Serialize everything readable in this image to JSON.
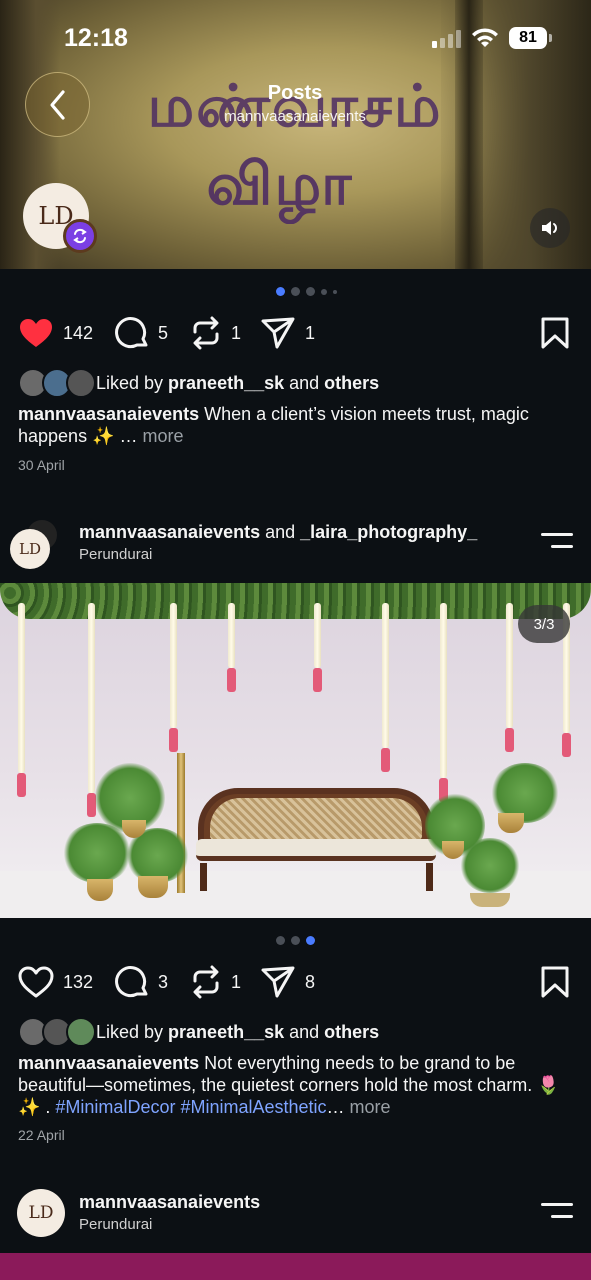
{
  "status_bar": {
    "time": "12:18",
    "battery": "81"
  },
  "header": {
    "title": "Posts",
    "subtitle": "mannvaasanaievents"
  },
  "top_post": {
    "overlay_text_line1": "மண்வாசம்",
    "overlay_text_line2": "விழா",
    "avatar_initials": "LD",
    "carousel": {
      "count": 5,
      "active_index": 0
    },
    "likes": "142",
    "comments": "5",
    "reposts": "1",
    "shares": "1",
    "liked_by_prefix": "Liked by ",
    "liked_by_user": "praneeth__sk",
    "liked_by_and": " and ",
    "liked_by_others": "others",
    "caption_user": "mannvaasanaievents",
    "caption_text": " When a client’s vision meets trust, magic happens ✨ … ",
    "more": "more",
    "date": "30 April"
  },
  "second_post": {
    "avatar_initials": "LD",
    "author": "mannvaasanaievents",
    "and": " and ",
    "collaborator": "_laira_photography_",
    "location": "Perundurai",
    "image_counter": "3/3",
    "carousel": {
      "count": 3,
      "active_index": 2
    },
    "likes": "132",
    "comments": "3",
    "reposts": "1",
    "shares": "8",
    "liked_by_prefix": "Liked by ",
    "liked_by_user": "praneeth__sk",
    "liked_by_and": " and ",
    "liked_by_others": "others",
    "caption_user": "mannvaasanaievents",
    "caption_text": " Not everything needs to be grand to be beautiful—sometimes, the quietest corners hold the most charm. 🌷 ✨ . ",
    "caption_tags": "#MinimalDecor #MinimalAesthetic",
    "caption_ellipsis": "… ",
    "more": "more",
    "date": "22 April"
  },
  "third_post": {
    "avatar_initials": "LD",
    "author": "mannvaasanaievents",
    "location": "Perundurai"
  },
  "colors": {
    "background": "#0c1014",
    "like_red": "#ff3040",
    "accent_blue": "#4a7cff",
    "repost_purple": "#7b3fe4",
    "hashtag": "#7fa4ff"
  },
  "icons": [
    "back-icon",
    "heart-icon",
    "comment-icon",
    "repost-icon",
    "share-icon",
    "bookmark-icon",
    "menu-icon",
    "speaker-icon",
    "wifi-icon",
    "signal-icon"
  ]
}
